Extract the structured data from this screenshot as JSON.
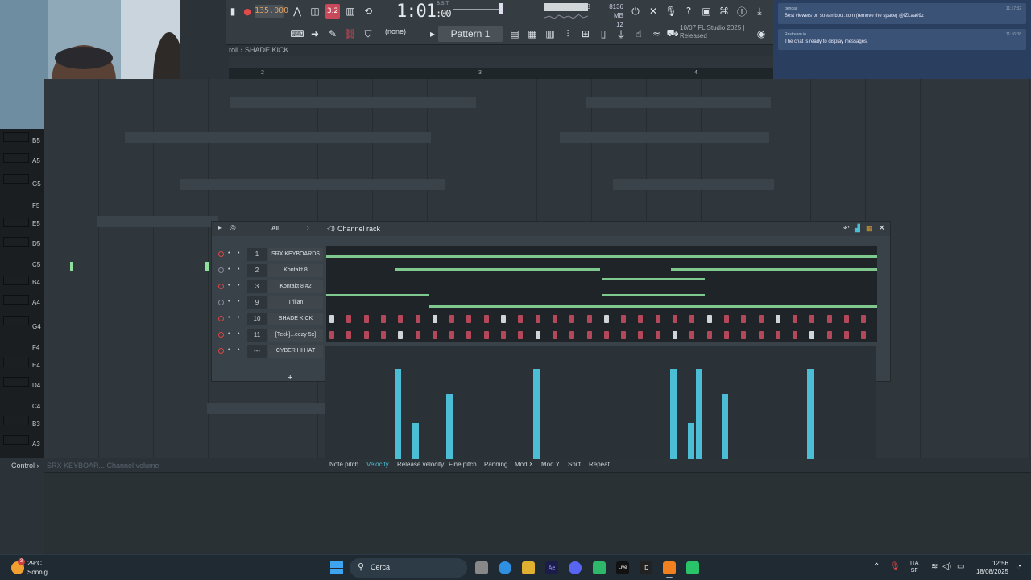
{
  "toolbar": {
    "tempo": "135.000",
    "time_main": "1:01",
    "time_sub": ":00",
    "time_label": "B:S:T",
    "none_label": "(none)",
    "pattern": "Pattern 1",
    "cpu": "38",
    "mem_line1": "8136 MB",
    "mem_line2": "12",
    "hint_line1": "10/07  FL Studio 2025 |",
    "hint_line2": "Released",
    "pink_label": "3.2"
  },
  "piano_roll": {
    "title": "roll › SHADE KICK",
    "ruler": [
      "2",
      "3",
      "4"
    ],
    "keys": [
      "B5",
      "A5",
      "G5",
      "F5",
      "E5",
      "D5",
      "C5",
      "B4",
      "A4",
      "G4",
      "F4",
      "E4",
      "D4",
      "C4",
      "B3",
      "A3"
    ]
  },
  "chat": {
    "messages": [
      {
        "user": "gendac",
        "text": "Best viewers on streamboo .com (remove the space) @iZLaa09z",
        "time": "11:17:32"
      },
      {
        "user": "Restream.io",
        "text": "The chat is ready to display messages.",
        "time": "11:16:08"
      }
    ]
  },
  "channel_rack": {
    "title": "Channel rack",
    "filter": "All",
    "add_label": "+",
    "channels": [
      {
        "num": "1",
        "name": "SRX KEYBOARDS",
        "active": true
      },
      {
        "num": "2",
        "name": "Kontakt 8",
        "active": false
      },
      {
        "num": "3",
        "name": "Kontakt 8 #2",
        "active": true
      },
      {
        "num": "9",
        "name": "Trilian",
        "active": false
      },
      {
        "num": "10",
        "name": "SHADE KICK",
        "active": true
      },
      {
        "num": "11",
        "name": "[Teck]...eezy 5x]",
        "active": true
      },
      {
        "num": "---",
        "name": "CYBER HI HAT",
        "active": true
      }
    ]
  },
  "event_editor": {
    "tabs": [
      "Note pitch",
      "Velocity",
      "Release velocity",
      "Fine pitch",
      "Panning",
      "Mod X",
      "Mod Y",
      "Shift",
      "Repeat"
    ],
    "active_tab": "Velocity",
    "velocities": [
      1.0,
      0.4,
      0.72,
      1.0,
      1.0,
      0.4,
      1.0,
      0.72,
      1.0
    ]
  },
  "control": {
    "label": "Control ›",
    "sub": "SRX KEYBOAR... Channel volume"
  },
  "taskbar": {
    "temp": "29°C",
    "condition": "Sonnig",
    "search": "Cerca",
    "lang1": "ITA",
    "lang2": "SF",
    "time": "12:56",
    "date": "18/08/2025",
    "badge": "3",
    "app_labels": [
      "Ae",
      "Live",
      "iD"
    ]
  },
  "colors": {
    "accent_cyan": "#4bbdd4",
    "melody_green": "#7fc98e",
    "step_red": "#b4485a",
    "step_white": "#cfd5d9",
    "chat_bg": "#2a3f5f"
  }
}
